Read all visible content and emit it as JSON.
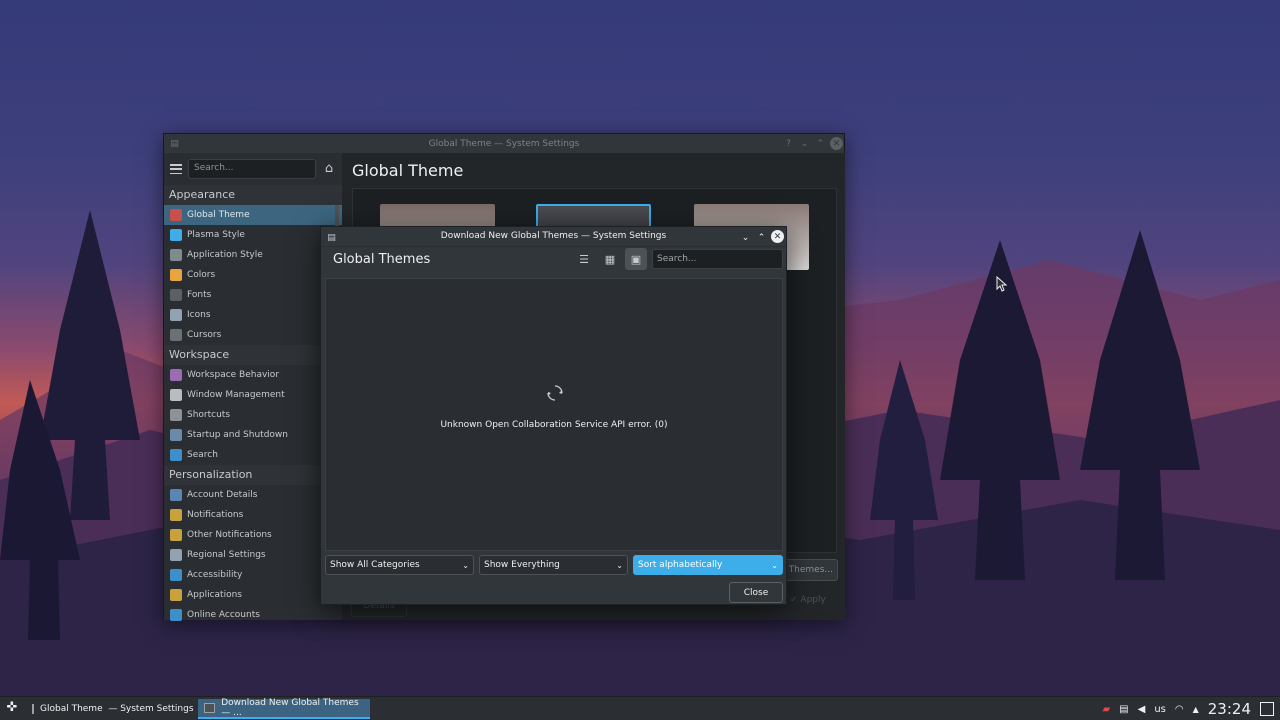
{
  "settings_window": {
    "title": "Global Theme — System Settings",
    "search_placeholder": "Search...",
    "page_title": "Global Theme",
    "categories": [
      {
        "label": "Appearance",
        "items": [
          {
            "label": "Global Theme",
            "icon": "global-theme-icon",
            "color": "#c94f4f",
            "active": true
          },
          {
            "label": "Plasma Style",
            "icon": "plasma-style-icon",
            "color": "#3daee9"
          },
          {
            "label": "Application Style",
            "icon": "application-style-icon",
            "color": "#7f8c8d"
          },
          {
            "label": "Colors",
            "icon": "colors-icon",
            "color": "#e9a53d"
          },
          {
            "label": "Fonts",
            "icon": "fonts-icon",
            "color": "#5a6066"
          },
          {
            "label": "Icons",
            "icon": "icons-icon",
            "color": "#8fa3b5"
          },
          {
            "label": "Cursors",
            "icon": "cursors-icon",
            "color": "#6b7075"
          }
        ]
      },
      {
        "label": "Workspace",
        "items": [
          {
            "label": "Workspace Behavior",
            "icon": "workspace-behavior-icon",
            "color": "#9b6bb5"
          },
          {
            "label": "Window Management",
            "icon": "window-management-icon",
            "color": "#b8bcc0"
          },
          {
            "label": "Shortcuts",
            "icon": "shortcuts-icon",
            "color": "#8d9297"
          },
          {
            "label": "Startup and Shutdown",
            "icon": "startup-shutdown-icon",
            "color": "#6b8aa8"
          },
          {
            "label": "Search",
            "icon": "search-icon",
            "color": "#3d8fc9"
          }
        ]
      },
      {
        "label": "Personalization",
        "items": [
          {
            "label": "Account Details",
            "icon": "account-details-icon",
            "color": "#5a85b5"
          },
          {
            "label": "Notifications",
            "icon": "notifications-icon",
            "color": "#c9a23d"
          },
          {
            "label": "Other Notifications",
            "icon": "other-notifications-icon",
            "color": "#c9a23d"
          },
          {
            "label": "Regional Settings",
            "icon": "regional-settings-icon",
            "color": "#8fa3b5"
          },
          {
            "label": "Accessibility",
            "icon": "accessibility-icon",
            "color": "#3d8fc9"
          },
          {
            "label": "Applications",
            "icon": "applications-icon",
            "color": "#c9a23d"
          },
          {
            "label": "Online Accounts",
            "icon": "online-accounts-icon",
            "color": "#3d8fc9"
          }
        ]
      }
    ],
    "get_themes_label": "Get New Global Themes...",
    "details_label": "Details",
    "apply_label": "Apply"
  },
  "dialog": {
    "title": "Download New Global Themes — System Settings",
    "header_title": "Global Themes",
    "search_placeholder": "Search...",
    "error_message": "Unknown Open Collaboration Service API error. (0)",
    "filter_categories": "Show All Categories",
    "filter_everything": "Show Everything",
    "sort_order": "Sort alphabetically",
    "close_label": "Close"
  },
  "taskbar": {
    "tasks": [
      {
        "label": "Global Theme  — System Settings",
        "active": false
      },
      {
        "label": "Download New Global Themes — ...",
        "active": true
      }
    ],
    "keyboard_layout": "us",
    "clock": "23:24"
  },
  "colors": {
    "accent": "#3daee9",
    "window_bg": "#232629",
    "active_item": "#3c6680"
  }
}
